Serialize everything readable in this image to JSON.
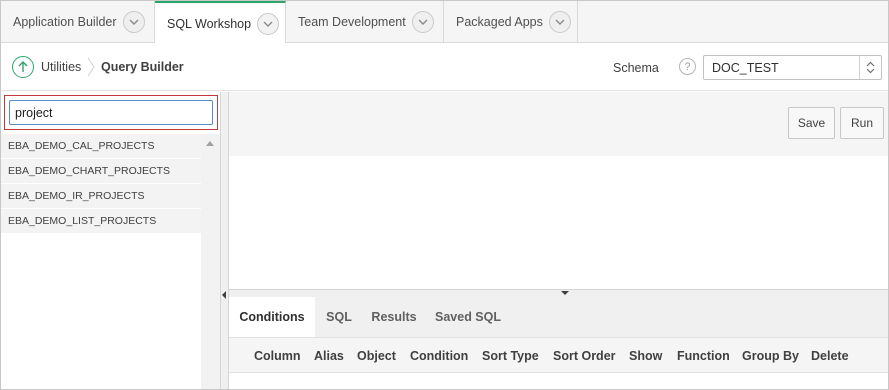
{
  "tabs": [
    {
      "label": "Application Builder",
      "active": false
    },
    {
      "label": "SQL Workshop",
      "active": true
    },
    {
      "label": "Team Development",
      "active": false
    },
    {
      "label": "Packaged Apps",
      "active": false
    }
  ],
  "breadcrumb": {
    "parent": "Utilities",
    "current": "Query Builder"
  },
  "schema": {
    "label": "Schema",
    "help": "?",
    "value": "DOC_TEST"
  },
  "search": {
    "value": "project"
  },
  "tables": [
    "EBA_DEMO_CAL_PROJECTS",
    "EBA_DEMO_CHART_PROJECTS",
    "EBA_DEMO_IR_PROJECTS",
    "EBA_DEMO_LIST_PROJECTS"
  ],
  "toolbar": {
    "save_label": "Save",
    "run_label": "Run"
  },
  "bottom_tabs": [
    {
      "label": "Conditions",
      "active": true
    },
    {
      "label": "SQL",
      "active": false
    },
    {
      "label": "Results",
      "active": false
    },
    {
      "label": "Saved SQL",
      "active": false
    }
  ],
  "columns": [
    "Column",
    "Alias",
    "Object",
    "Condition",
    "Sort Type",
    "Sort Order",
    "Show",
    "Function",
    "Group By",
    "Delete"
  ],
  "colors": {
    "accent": "#2ea56b",
    "focus_border": "#4f8ec9",
    "highlight_outline": "#c0393b"
  },
  "icons": {
    "tab_menu": "chevron-down-icon",
    "up": "arrow-up-circle-icon",
    "help": "help-icon",
    "select": "select-arrows-icon"
  }
}
